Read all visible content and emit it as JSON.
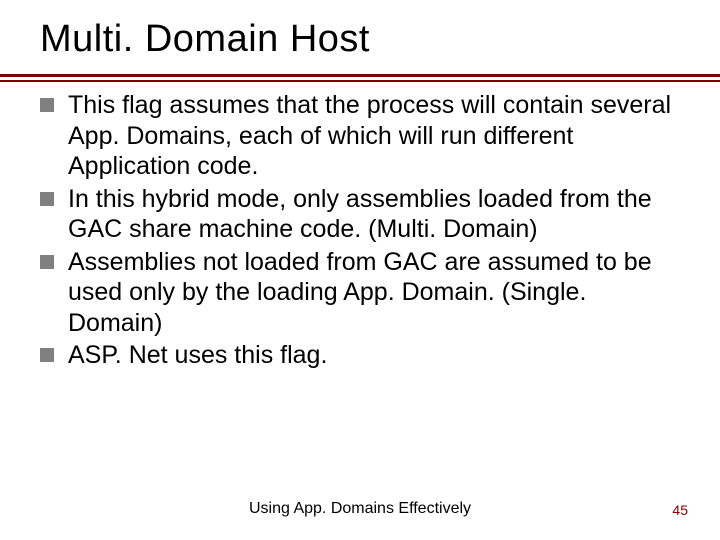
{
  "title": "Multi. Domain Host",
  "bullets": [
    "This flag assumes that the process will contain several App. Domains, each of which will run different Application code.",
    "In this hybrid mode, only assemblies loaded from the GAC share machine code. (Multi. Domain)",
    " Assemblies not loaded from GAC are assumed to be used only by the loading App. Domain. (Single. Domain)",
    "ASP. Net uses this flag."
  ],
  "footer": {
    "center": "Using App. Domains Effectively",
    "page": "45"
  },
  "colors": {
    "accent": "#800000",
    "bullet": "#808080"
  }
}
